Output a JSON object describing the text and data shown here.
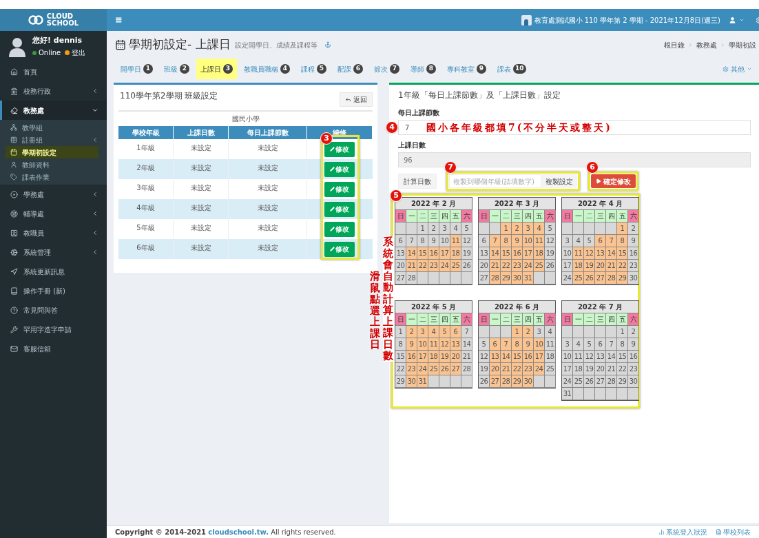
{
  "sidebar": {
    "logo": {
      "line1": "CLOUD",
      "line2": "SCHOOL"
    },
    "user": {
      "greeting": "您好! dennis",
      "status": "Online",
      "logout": "登出"
    },
    "items": [
      {
        "label": "首頁",
        "selected": false
      },
      {
        "label": "校務行政",
        "selected": false,
        "expanded": false
      },
      {
        "label": "教務處",
        "selected": true,
        "expanded": true,
        "children": [
          {
            "label": "教學組",
            "selected": false
          },
          {
            "label": "註冊組",
            "selected": false,
            "expanded": false
          },
          {
            "label": "學期初設定",
            "selected": true
          },
          {
            "label": "教師資料",
            "selected": false
          },
          {
            "label": "課表作業",
            "selected": false
          }
        ]
      },
      {
        "label": "學務處",
        "selected": false,
        "expanded": false
      },
      {
        "label": "輔導處",
        "selected": false,
        "expanded": false
      },
      {
        "label": "教職員",
        "selected": false,
        "expanded": false
      },
      {
        "label": "系統管理",
        "selected": false,
        "expanded": false
      },
      {
        "label": "系統更新訊息",
        "selected": false
      },
      {
        "label": "操作手冊 (新)",
        "selected": false
      },
      {
        "label": "常見問與答",
        "selected": false
      },
      {
        "label": "罕用字造字申請",
        "selected": false
      },
      {
        "label": "客服信箱",
        "selected": false
      }
    ]
  },
  "top_bar": {
    "menu": "≡",
    "school_info": "教育處測試國小 110 學年第 2 學期 - 2021年12月8日(週三)"
  },
  "page_header": {
    "title": "學期初設定- 上課日",
    "subtitle": "設定開學日、成績及課程等",
    "breadcrumb": [
      "根目錄",
      "教務處",
      "學期初設"
    ]
  },
  "tabs": [
    {
      "label": "開學日",
      "badge": "1",
      "selected": false
    },
    {
      "label": "班級",
      "badge": "2",
      "selected": false
    },
    {
      "label": "上課日",
      "badge": "3",
      "selected": true
    },
    {
      "label": "教職員職稱",
      "badge": "4",
      "selected": false
    },
    {
      "label": "課程",
      "badge": "5",
      "selected": false
    },
    {
      "label": "配課",
      "badge": "6",
      "selected": false
    },
    {
      "label": "節次",
      "badge": "7",
      "selected": false
    },
    {
      "label": "導師",
      "badge": "8",
      "selected": false
    },
    {
      "label": "專科教室",
      "badge": "9",
      "selected": false
    },
    {
      "label": "課表",
      "badge": "10",
      "selected": false
    }
  ],
  "other_menu": "其他",
  "left_panel": {
    "title": "110學年第2學期 班級設定",
    "back_button": "返回",
    "caption": "國民小學",
    "step_badge": "3",
    "columns": [
      "學校年級",
      "上課日數",
      "每日上課節數",
      "編修"
    ],
    "rows": [
      {
        "grade": "1年級",
        "days": "未設定",
        "periods": "未設定",
        "action": "修改"
      },
      {
        "grade": "2年級",
        "days": "未設定",
        "periods": "未設定",
        "action": "修改"
      },
      {
        "grade": "3年級",
        "days": "未設定",
        "periods": "未設定",
        "action": "修改"
      },
      {
        "grade": "4年級",
        "days": "未設定",
        "periods": "未設定",
        "action": "修改"
      },
      {
        "grade": "5年級",
        "days": "未設定",
        "periods": "未設定",
        "action": "修改"
      },
      {
        "grade": "6年級",
        "days": "未設定",
        "periods": "未設定",
        "action": "修改"
      }
    ]
  },
  "right_panel": {
    "title": "1年級「每日上課節數」及「上課日數」設定",
    "periods": {
      "label": "每日上課節數",
      "value": "7",
      "step_badge": "4",
      "note": "國小各年級都填7(不分半天或整天)"
    },
    "days": {
      "label": "上課日數",
      "value": "96",
      "disabled": true
    },
    "calc_button": "計算日數",
    "copy": {
      "placeholder": "複製到哪個年級(請填數字)",
      "button": "複製設定",
      "step_badge": "7"
    },
    "confirm": {
      "button": "確定修改",
      "step_badge": "6"
    },
    "calendar": {
      "step_badge": "5",
      "notes": [
        "滑鼠點選上課日",
        "系統會自動計算上課日數"
      ],
      "months": [
        {
          "title": "2022 年 2 月",
          "weekdays": [
            {
              "label": "日",
              "kind": "weekend"
            },
            {
              "label": "一",
              "kind": "weekday"
            },
            {
              "label": "二",
              "kind": "weekday"
            },
            {
              "label": "三",
              "kind": "weekday"
            },
            {
              "label": "四",
              "kind": "weekday"
            },
            {
              "label": "五",
              "kind": "weekday"
            },
            {
              "label": "六",
              "kind": "weekend"
            }
          ],
          "weeks": [
            [
              {
                "kind": "blank"
              },
              {
                "kind": "blank"
              },
              {
                "kind": "day",
                "day": "1",
                "selected": false
              },
              {
                "kind": "day",
                "day": "2",
                "selected": false
              },
              {
                "kind": "day",
                "day": "3",
                "selected": false
              },
              {
                "kind": "day",
                "day": "4",
                "selected": false
              },
              {
                "kind": "day",
                "day": "5",
                "selected": false
              }
            ],
            [
              {
                "kind": "day",
                "day": "6",
                "selected": false
              },
              {
                "kind": "day",
                "day": "7",
                "selected": false
              },
              {
                "kind": "day",
                "day": "8",
                "selected": false
              },
              {
                "kind": "day",
                "day": "9",
                "selected": false
              },
              {
                "kind": "day",
                "day": "10",
                "selected": false
              },
              {
                "kind": "day",
                "day": "11",
                "selected": true
              },
              {
                "kind": "day",
                "day": "12",
                "selected": false
              }
            ],
            [
              {
                "kind": "day",
                "day": "13",
                "selected": false
              },
              {
                "kind": "day",
                "day": "14",
                "selected": true
              },
              {
                "kind": "day",
                "day": "15",
                "selected": true
              },
              {
                "kind": "day",
                "day": "16",
                "selected": true
              },
              {
                "kind": "day",
                "day": "17",
                "selected": true
              },
              {
                "kind": "day",
                "day": "18",
                "selected": true
              },
              {
                "kind": "day",
                "day": "19",
                "selected": false
              }
            ],
            [
              {
                "kind": "day",
                "day": "20",
                "selected": false
              },
              {
                "kind": "day",
                "day": "21",
                "selected": true
              },
              {
                "kind": "day",
                "day": "22",
                "selected": true
              },
              {
                "kind": "day",
                "day": "23",
                "selected": true
              },
              {
                "kind": "day",
                "day": "24",
                "selected": true
              },
              {
                "kind": "day",
                "day": "25",
                "selected": true
              },
              {
                "kind": "day",
                "day": "26",
                "selected": false
              }
            ],
            [
              {
                "kind": "day",
                "day": "27",
                "selected": false
              },
              {
                "kind": "day",
                "day": "28",
                "selected": false
              },
              {
                "kind": "blank"
              },
              {
                "kind": "blank"
              },
              {
                "kind": "blank"
              },
              {
                "kind": "blank"
              },
              {
                "kind": "blank"
              }
            ]
          ]
        },
        {
          "title": "2022 年 3 月",
          "weekdays": [
            {
              "label": "日",
              "kind": "weekend"
            },
            {
              "label": "一",
              "kind": "weekday"
            },
            {
              "label": "二",
              "kind": "weekday"
            },
            {
              "label": "三",
              "kind": "weekday"
            },
            {
              "label": "四",
              "kind": "weekday"
            },
            {
              "label": "五",
              "kind": "weekday"
            },
            {
              "label": "六",
              "kind": "weekend"
            }
          ],
          "weeks": [
            [
              {
                "kind": "blank"
              },
              {
                "kind": "blank"
              },
              {
                "kind": "day",
                "day": "1",
                "selected": true
              },
              {
                "kind": "day",
                "day": "2",
                "selected": true
              },
              {
                "kind": "day",
                "day": "3",
                "selected": true
              },
              {
                "kind": "day",
                "day": "4",
                "selected": true
              },
              {
                "kind": "day",
                "day": "5",
                "selected": false
              }
            ],
            [
              {
                "kind": "day",
                "day": "6",
                "selected": false
              },
              {
                "kind": "day",
                "day": "7",
                "selected": true
              },
              {
                "kind": "day",
                "day": "8",
                "selected": true
              },
              {
                "kind": "day",
                "day": "9",
                "selected": true
              },
              {
                "kind": "day",
                "day": "10",
                "selected": true
              },
              {
                "kind": "day",
                "day": "11",
                "selected": true
              },
              {
                "kind": "day",
                "day": "12",
                "selected": false
              }
            ],
            [
              {
                "kind": "day",
                "day": "13",
                "selected": false
              },
              {
                "kind": "day",
                "day": "14",
                "selected": true
              },
              {
                "kind": "day",
                "day": "15",
                "selected": true
              },
              {
                "kind": "day",
                "day": "16",
                "selected": true
              },
              {
                "kind": "day",
                "day": "17",
                "selected": true
              },
              {
                "kind": "day",
                "day": "18",
                "selected": true
              },
              {
                "kind": "day",
                "day": "19",
                "selected": false
              }
            ],
            [
              {
                "kind": "day",
                "day": "20",
                "selected": false
              },
              {
                "kind": "day",
                "day": "21",
                "selected": true
              },
              {
                "kind": "day",
                "day": "22",
                "selected": true
              },
              {
                "kind": "day",
                "day": "23",
                "selected": true
              },
              {
                "kind": "day",
                "day": "24",
                "selected": true
              },
              {
                "kind": "day",
                "day": "25",
                "selected": true
              },
              {
                "kind": "day",
                "day": "26",
                "selected": false
              }
            ],
            [
              {
                "kind": "day",
                "day": "27",
                "selected": false
              },
              {
                "kind": "day",
                "day": "28",
                "selected": true
              },
              {
                "kind": "day",
                "day": "29",
                "selected": true
              },
              {
                "kind": "day",
                "day": "30",
                "selected": true
              },
              {
                "kind": "day",
                "day": "31",
                "selected": true
              },
              {
                "kind": "blank"
              },
              {
                "kind": "blank"
              }
            ]
          ]
        },
        {
          "title": "2022 年 4 月",
          "weekdays": [
            {
              "label": "日",
              "kind": "weekend"
            },
            {
              "label": "一",
              "kind": "weekday"
            },
            {
              "label": "二",
              "kind": "weekday"
            },
            {
              "label": "三",
              "kind": "weekday"
            },
            {
              "label": "四",
              "kind": "weekday"
            },
            {
              "label": "五",
              "kind": "weekday"
            },
            {
              "label": "六",
              "kind": "weekend"
            }
          ],
          "weeks": [
            [
              {
                "kind": "blank"
              },
              {
                "kind": "blank"
              },
              {
                "kind": "blank"
              },
              {
                "kind": "blank"
              },
              {
                "kind": "blank"
              },
              {
                "kind": "day",
                "day": "1",
                "selected": true
              },
              {
                "kind": "day",
                "day": "2",
                "selected": false
              }
            ],
            [
              {
                "kind": "day",
                "day": "3",
                "selected": false
              },
              {
                "kind": "day",
                "day": "4",
                "selected": false
              },
              {
                "kind": "day",
                "day": "5",
                "selected": false
              },
              {
                "kind": "day",
                "day": "6",
                "selected": true
              },
              {
                "kind": "day",
                "day": "7",
                "selected": true
              },
              {
                "kind": "day",
                "day": "8",
                "selected": true
              },
              {
                "kind": "day",
                "day": "9",
                "selected": false
              }
            ],
            [
              {
                "kind": "day",
                "day": "10",
                "selected": false
              },
              {
                "kind": "day",
                "day": "11",
                "selected": true
              },
              {
                "kind": "day",
                "day": "12",
                "selected": true
              },
              {
                "kind": "day",
                "day": "13",
                "selected": true
              },
              {
                "kind": "day",
                "day": "14",
                "selected": true
              },
              {
                "kind": "day",
                "day": "15",
                "selected": true
              },
              {
                "kind": "day",
                "day": "16",
                "selected": false
              }
            ],
            [
              {
                "kind": "day",
                "day": "17",
                "selected": false
              },
              {
                "kind": "day",
                "day": "18",
                "selected": true
              },
              {
                "kind": "day",
                "day": "19",
                "selected": true
              },
              {
                "kind": "day",
                "day": "20",
                "selected": true
              },
              {
                "kind": "day",
                "day": "21",
                "selected": true
              },
              {
                "kind": "day",
                "day": "22",
                "selected": true
              },
              {
                "kind": "day",
                "day": "23",
                "selected": false
              }
            ],
            [
              {
                "kind": "day",
                "day": "24",
                "selected": false
              },
              {
                "kind": "day",
                "day": "25",
                "selected": true
              },
              {
                "kind": "day",
                "day": "26",
                "selected": true
              },
              {
                "kind": "day",
                "day": "27",
                "selected": true
              },
              {
                "kind": "day",
                "day": "28",
                "selected": true
              },
              {
                "kind": "day",
                "day": "29",
                "selected": true
              },
              {
                "kind": "day",
                "day": "30",
                "selected": false
              }
            ]
          ]
        },
        {
          "title": "2022 年 5 月",
          "weekdays": [
            {
              "label": "日",
              "kind": "weekend"
            },
            {
              "label": "一",
              "kind": "weekday"
            },
            {
              "label": "二",
              "kind": "weekday"
            },
            {
              "label": "三",
              "kind": "weekday"
            },
            {
              "label": "四",
              "kind": "weekday"
            },
            {
              "label": "五",
              "kind": "weekday"
            },
            {
              "label": "六",
              "kind": "weekend"
            }
          ],
          "weeks": [
            [
              {
                "kind": "day",
                "day": "1",
                "selected": false
              },
              {
                "kind": "day",
                "day": "2",
                "selected": true
              },
              {
                "kind": "day",
                "day": "3",
                "selected": true
              },
              {
                "kind": "day",
                "day": "4",
                "selected": true
              },
              {
                "kind": "day",
                "day": "5",
                "selected": true
              },
              {
                "kind": "day",
                "day": "6",
                "selected": true
              },
              {
                "kind": "day",
                "day": "7",
                "selected": false
              }
            ],
            [
              {
                "kind": "day",
                "day": "8",
                "selected": false
              },
              {
                "kind": "day",
                "day": "9",
                "selected": true
              },
              {
                "kind": "day",
                "day": "10",
                "selected": true
              },
              {
                "kind": "day",
                "day": "11",
                "selected": true
              },
              {
                "kind": "day",
                "day": "12",
                "selected": true
              },
              {
                "kind": "day",
                "day": "13",
                "selected": true
              },
              {
                "kind": "day",
                "day": "14",
                "selected": false
              }
            ],
            [
              {
                "kind": "day",
                "day": "15",
                "selected": false
              },
              {
                "kind": "day",
                "day": "16",
                "selected": true
              },
              {
                "kind": "day",
                "day": "17",
                "selected": true
              },
              {
                "kind": "day",
                "day": "18",
                "selected": true
              },
              {
                "kind": "day",
                "day": "19",
                "selected": true
              },
              {
                "kind": "day",
                "day": "20",
                "selected": true
              },
              {
                "kind": "day",
                "day": "21",
                "selected": false
              }
            ],
            [
              {
                "kind": "day",
                "day": "22",
                "selected": false
              },
              {
                "kind": "day",
                "day": "23",
                "selected": true
              },
              {
                "kind": "day",
                "day": "24",
                "selected": true
              },
              {
                "kind": "day",
                "day": "25",
                "selected": true
              },
              {
                "kind": "day",
                "day": "26",
                "selected": true
              },
              {
                "kind": "day",
                "day": "27",
                "selected": true
              },
              {
                "kind": "day",
                "day": "28",
                "selected": false
              }
            ],
            [
              {
                "kind": "day",
                "day": "29",
                "selected": false
              },
              {
                "kind": "day",
                "day": "30",
                "selected": true
              },
              {
                "kind": "day",
                "day": "31",
                "selected": true
              },
              {
                "kind": "blank"
              },
              {
                "kind": "blank"
              },
              {
                "kind": "blank"
              },
              {
                "kind": "blank"
              }
            ]
          ]
        },
        {
          "title": "2022 年 6 月",
          "weekdays": [
            {
              "label": "日",
              "kind": "weekend"
            },
            {
              "label": "一",
              "kind": "weekday"
            },
            {
              "label": "二",
              "kind": "weekday"
            },
            {
              "label": "三",
              "kind": "weekday"
            },
            {
              "label": "四",
              "kind": "weekday"
            },
            {
              "label": "五",
              "kind": "weekday"
            },
            {
              "label": "六",
              "kind": "weekend"
            }
          ],
          "weeks": [
            [
              {
                "kind": "blank"
              },
              {
                "kind": "blank"
              },
              {
                "kind": "blank"
              },
              {
                "kind": "day",
                "day": "1",
                "selected": true
              },
              {
                "kind": "day",
                "day": "2",
                "selected": true
              },
              {
                "kind": "day",
                "day": "3",
                "selected": false
              },
              {
                "kind": "day",
                "day": "4",
                "selected": false
              }
            ],
            [
              {
                "kind": "day",
                "day": "5",
                "selected": false
              },
              {
                "kind": "day",
                "day": "6",
                "selected": true
              },
              {
                "kind": "day",
                "day": "7",
                "selected": true
              },
              {
                "kind": "day",
                "day": "8",
                "selected": true
              },
              {
                "kind": "day",
                "day": "9",
                "selected": true
              },
              {
                "kind": "day",
                "day": "10",
                "selected": true
              },
              {
                "kind": "day",
                "day": "11",
                "selected": false
              }
            ],
            [
              {
                "kind": "day",
                "day": "12",
                "selected": false
              },
              {
                "kind": "day",
                "day": "13",
                "selected": true
              },
              {
                "kind": "day",
                "day": "14",
                "selected": true
              },
              {
                "kind": "day",
                "day": "15",
                "selected": true
              },
              {
                "kind": "day",
                "day": "16",
                "selected": true
              },
              {
                "kind": "day",
                "day": "17",
                "selected": true
              },
              {
                "kind": "day",
                "day": "18",
                "selected": false
              }
            ],
            [
              {
                "kind": "day",
                "day": "19",
                "selected": false
              },
              {
                "kind": "day",
                "day": "20",
                "selected": true
              },
              {
                "kind": "day",
                "day": "21",
                "selected": true
              },
              {
                "kind": "day",
                "day": "22",
                "selected": true
              },
              {
                "kind": "day",
                "day": "23",
                "selected": true
              },
              {
                "kind": "day",
                "day": "24",
                "selected": true
              },
              {
                "kind": "day",
                "day": "25",
                "selected": false
              }
            ],
            [
              {
                "kind": "day",
                "day": "26",
                "selected": false
              },
              {
                "kind": "day",
                "day": "27",
                "selected": true
              },
              {
                "kind": "day",
                "day": "28",
                "selected": true
              },
              {
                "kind": "day",
                "day": "29",
                "selected": true
              },
              {
                "kind": "day",
                "day": "30",
                "selected": true
              },
              {
                "kind": "blank"
              },
              {
                "kind": "blank"
              }
            ]
          ]
        },
        {
          "title": "2022 年 7 月",
          "weekdays": [
            {
              "label": "日",
              "kind": "weekend"
            },
            {
              "label": "一",
              "kind": "weekday"
            },
            {
              "label": "二",
              "kind": "weekday"
            },
            {
              "label": "三",
              "kind": "weekday"
            },
            {
              "label": "四",
              "kind": "weekday"
            },
            {
              "label": "五",
              "kind": "weekday"
            },
            {
              "label": "六",
              "kind": "weekend"
            }
          ],
          "weeks": [
            [
              {
                "kind": "blank"
              },
              {
                "kind": "blank"
              },
              {
                "kind": "blank"
              },
              {
                "kind": "blank"
              },
              {
                "kind": "blank"
              },
              {
                "kind": "day",
                "day": "1",
                "selected": false
              },
              {
                "kind": "day",
                "day": "2",
                "selected": false
              }
            ],
            [
              {
                "kind": "day",
                "day": "3",
                "selected": false
              },
              {
                "kind": "day",
                "day": "4",
                "selected": false
              },
              {
                "kind": "day",
                "day": "5",
                "selected": false
              },
              {
                "kind": "day",
                "day": "6",
                "selected": false
              },
              {
                "kind": "day",
                "day": "7",
                "selected": false
              },
              {
                "kind": "day",
                "day": "8",
                "selected": false
              },
              {
                "kind": "day",
                "day": "9",
                "selected": false
              }
            ],
            [
              {
                "kind": "day",
                "day": "10",
                "selected": false
              },
              {
                "kind": "day",
                "day": "11",
                "selected": false
              },
              {
                "kind": "day",
                "day": "12",
                "selected": false
              },
              {
                "kind": "day",
                "day": "13",
                "selected": false
              },
              {
                "kind": "day",
                "day": "14",
                "selected": false
              },
              {
                "kind": "day",
                "day": "15",
                "selected": false
              },
              {
                "kind": "day",
                "day": "16",
                "selected": false
              }
            ],
            [
              {
                "kind": "day",
                "day": "17",
                "selected": false
              },
              {
                "kind": "day",
                "day": "18",
                "selected": false
              },
              {
                "kind": "day",
                "day": "19",
                "selected": false
              },
              {
                "kind": "day",
                "day": "20",
                "selected": false
              },
              {
                "kind": "day",
                "day": "21",
                "selected": false
              },
              {
                "kind": "day",
                "day": "22",
                "selected": false
              },
              {
                "kind": "day",
                "day": "23",
                "selected": false
              }
            ],
            [
              {
                "kind": "day",
                "day": "24",
                "selected": false
              },
              {
                "kind": "day",
                "day": "25",
                "selected": false
              },
              {
                "kind": "day",
                "day": "26",
                "selected": false
              },
              {
                "kind": "day",
                "day": "27",
                "selected": false
              },
              {
                "kind": "day",
                "day": "28",
                "selected": false
              },
              {
                "kind": "day",
                "day": "29",
                "selected": false
              },
              {
                "kind": "day",
                "day": "30",
                "selected": false
              }
            ],
            [
              {
                "kind": "day",
                "day": "31",
                "selected": false
              },
              {
                "kind": "blank"
              },
              {
                "kind": "blank"
              },
              {
                "kind": "blank"
              },
              {
                "kind": "blank"
              },
              {
                "kind": "blank"
              },
              {
                "kind": "blank"
              }
            ]
          ]
        }
      ]
    }
  },
  "footer": {
    "copyright": "Copyright © 2014-2021",
    "link": "cloudschool.tw.",
    "rights": "All rights reserved.",
    "links": [
      "系統登入狀況",
      "學校列表"
    ]
  }
}
